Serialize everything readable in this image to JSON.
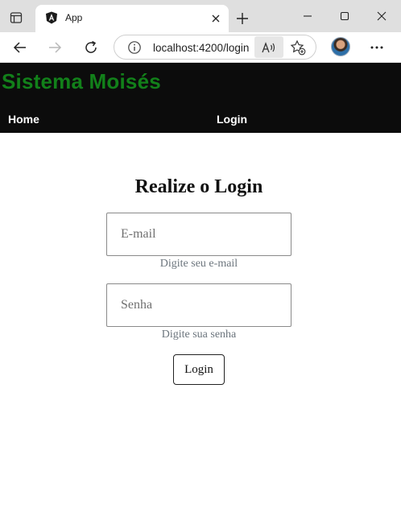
{
  "browser": {
    "tab": {
      "title": "App"
    },
    "address": {
      "url": "localhost:4200/login"
    }
  },
  "app": {
    "brand": "Sistema Moisés",
    "nav": {
      "home": "Home",
      "login": "Login"
    }
  },
  "login_form": {
    "title": "Realize o Login",
    "email": {
      "placeholder": "E-mail",
      "value": "",
      "hint": "Digite seu e-mail"
    },
    "password": {
      "placeholder": "Senha",
      "value": "",
      "hint": "Digite sua senha"
    },
    "submit_label": "Login"
  },
  "colors": {
    "brand": "#12801a",
    "header_bg": "#0c0c0c",
    "hint": "#6c757d"
  }
}
